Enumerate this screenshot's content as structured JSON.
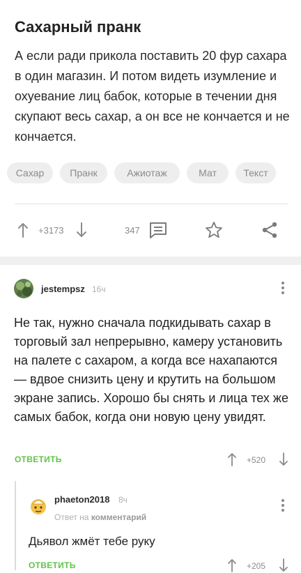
{
  "post": {
    "title": "Сахарный пранк",
    "body": "А если ради прикола поставить 20 фур сахара в один магазин. И потом видеть изумление  и охуевание лиц бабок, которые в течении дня скупают весь сахар, а он все не кончается и не кончается.",
    "tags": [
      "Сахар",
      "Пранк",
      "Ажиотаж",
      "Мат",
      "Текст"
    ],
    "rating": "+3173",
    "comments_count": "347"
  },
  "comment": {
    "username": "jestempsz",
    "time": "16ч",
    "text": "Не так, нужно сначала подкидывать сахар в торговый зал непрерывно, камеру установить на палете с сахаром, а когда все нахапаются — вдвое снизить цену и крутить на большом экране запись. Хорошо бы снять и лица тех же самых бабок, когда они новую цену увидят.",
    "reply_label": "ОТВЕТИТЬ",
    "rating": "+520"
  },
  "reply": {
    "username": "phaeton2018",
    "time": "8ч",
    "reply_to_prefix": "Ответ на",
    "reply_to_target": "комментарий",
    "text": "Дьявол жмёт тебе руку",
    "reply_label": "ОТВЕТИТЬ",
    "rating": "+205"
  },
  "colors": {
    "accent_green": "#62c34b",
    "tag_bg": "#eeeeee",
    "section_gap": "#f0f0f0"
  },
  "icons": [
    "arrow-up-icon",
    "arrow-down-icon",
    "comments-icon",
    "star-icon",
    "share-icon",
    "more-icon"
  ]
}
